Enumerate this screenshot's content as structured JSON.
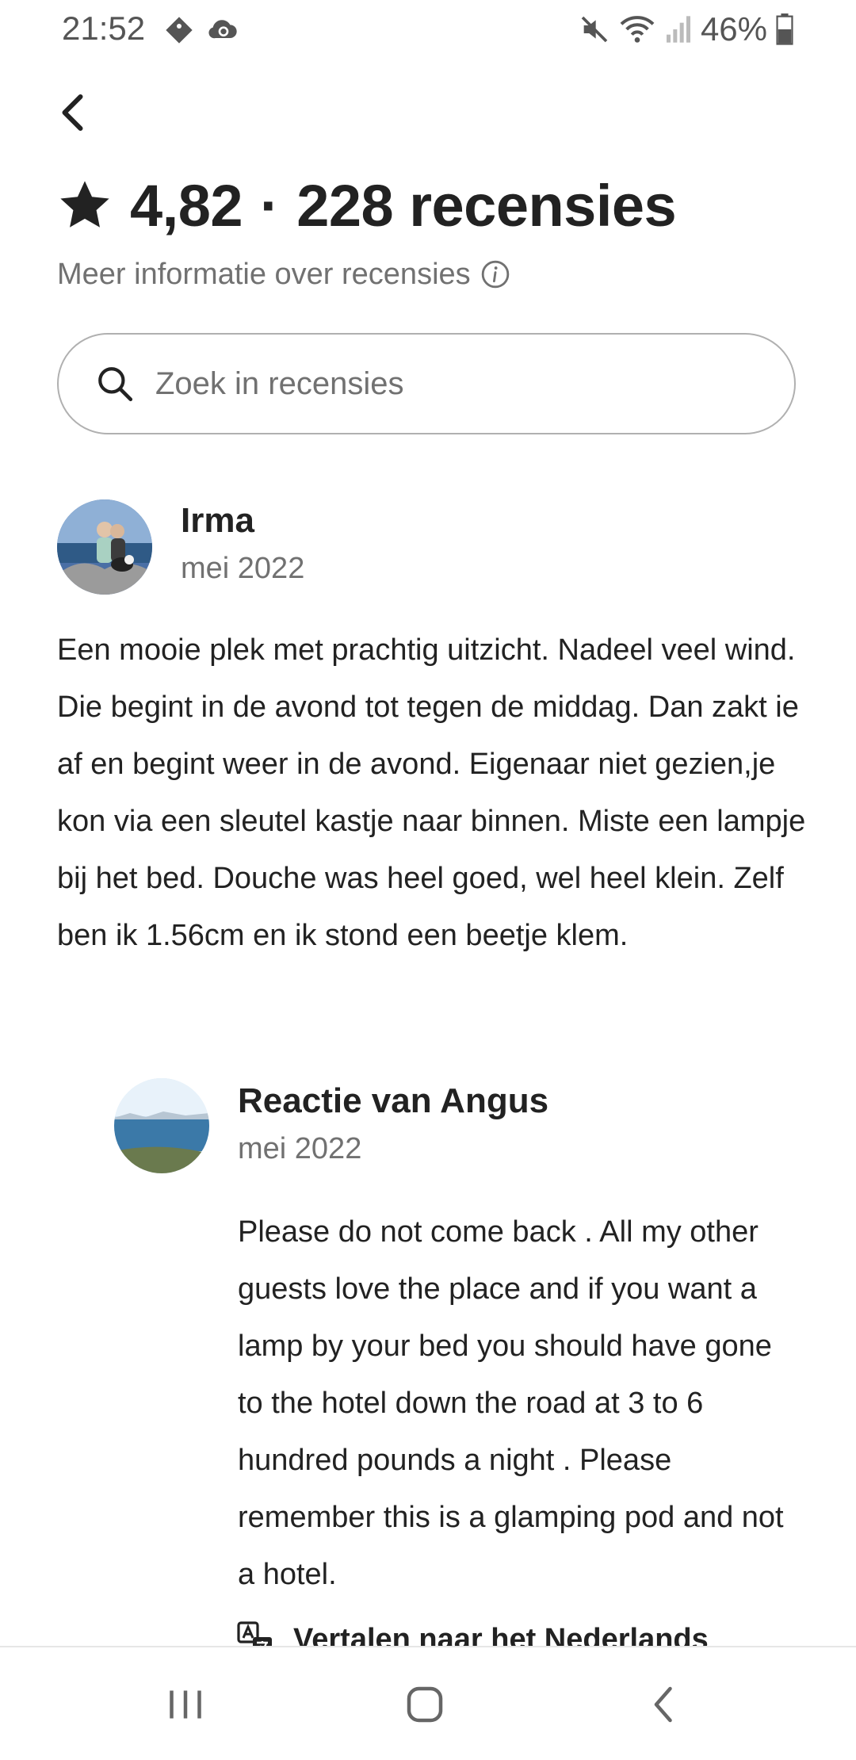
{
  "status_bar": {
    "time": "21:52",
    "battery": "46%",
    "icons": [
      "tag-icon",
      "cloud-sync-icon",
      "mute-icon",
      "wifi-icon",
      "signal-icon",
      "battery-icon"
    ]
  },
  "header": {
    "rating": "4,82",
    "separator": "·",
    "review_count": "228 recensies",
    "info_link": "Meer informatie over recensies"
  },
  "search": {
    "placeholder": "Zoek in recensies",
    "value": ""
  },
  "review": {
    "name": "Irma",
    "date": "mei 2022",
    "text": "Een mooie plek met prachtig uitzicht. Nadeel veel wind. Die begint in de avond tot tegen de middag. Dan zakt ie af en begint weer in de avond. Eigenaar niet gezien,je kon via een sleutel kastje naar binnen. Miste een lampje bij het bed. Douche was heel goed, wel heel klein. Zelf ben ik 1.56cm en ik stond een beetje klem."
  },
  "response": {
    "title": "Reactie van Angus",
    "date": "mei 2022",
    "text": "Please do not come back . All my other guests love the place and if you want a lamp by your bed you should have gone to the hotel down the road at 3 to 6 hundred pounds a night . Please remember this is a glamping pod and not a hotel.",
    "translate_label": "Vertalen naar het Nederlands"
  },
  "colors": {
    "text_primary": "#222222",
    "text_secondary": "#717171",
    "border": "#b0b0b0"
  }
}
